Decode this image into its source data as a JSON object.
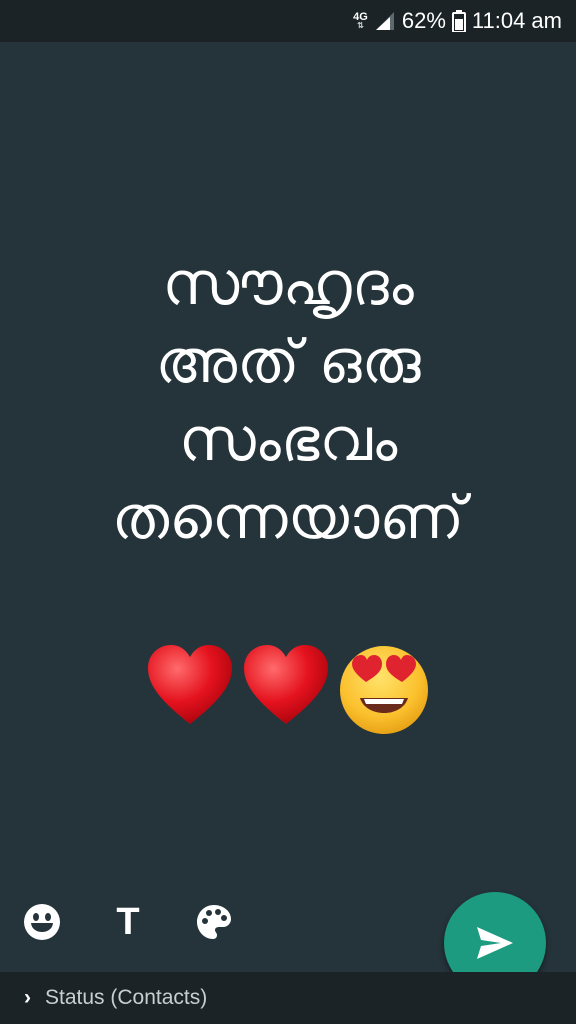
{
  "status_bar": {
    "network": "4G",
    "battery_percent": "62%",
    "time": "11:04 am"
  },
  "status_text": {
    "lines": [
      "സൗഹൃദം",
      "അത് ഒരു",
      "സംഭവം",
      "തന്നെയാണ്"
    ],
    "emojis": [
      "red-heart",
      "red-heart",
      "smiling-face-with-heart-eyes"
    ]
  },
  "tools": {
    "emoji": "smiley-icon",
    "text_label": "T",
    "color": "palette-icon"
  },
  "send": {
    "icon": "send-icon",
    "color": "#1c9b80"
  },
  "footer": {
    "chevron": "›",
    "recipient_label": "Status (Contacts)"
  },
  "colors": {
    "background": "#25343a",
    "bars": "#1b2326"
  }
}
